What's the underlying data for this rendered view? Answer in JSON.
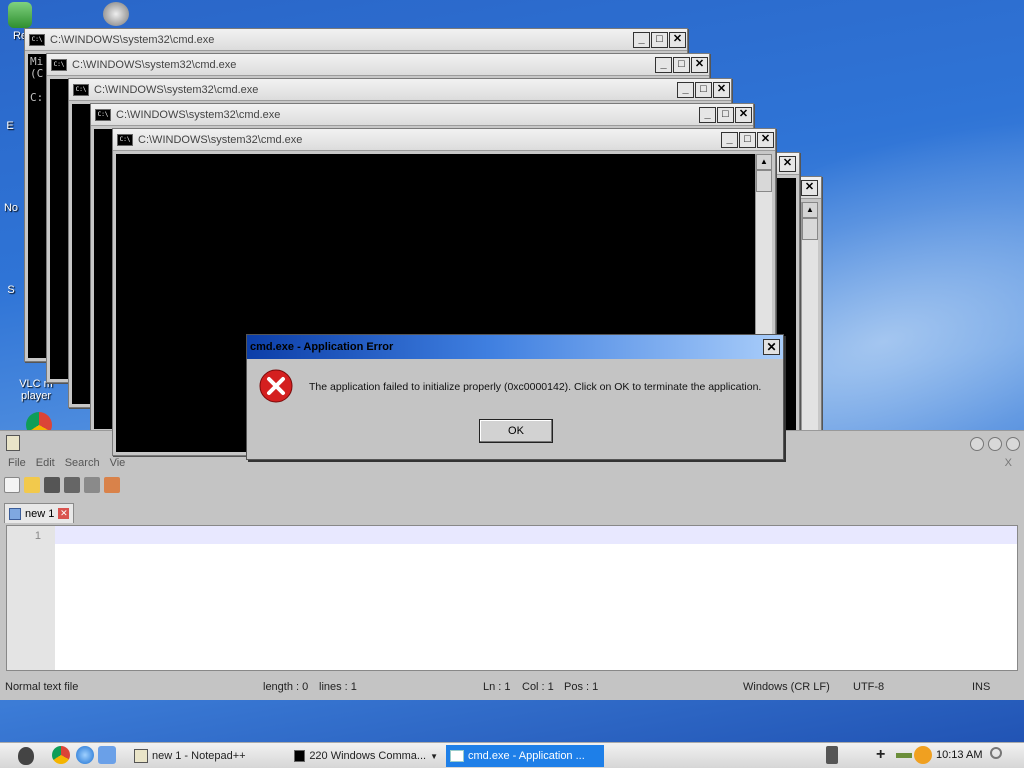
{
  "desktop": {
    "icons": [
      {
        "label": "Re"
      },
      {
        "label": "E"
      },
      {
        "label": "No"
      },
      {
        "label": "S"
      },
      {
        "label": "VLC m\nplayer"
      }
    ]
  },
  "cmd_windows": [
    {
      "title": "C:\\WINDOWS\\system32\\cmd.exe",
      "body_lines": [
        "Mi",
        "(C",
        "",
        "C:"
      ]
    },
    {
      "title": "C:\\WINDOWS\\system32\\cmd.exe"
    },
    {
      "title": "C:\\WINDOWS\\system32\\cmd.exe"
    },
    {
      "title": "C:\\WINDOWS\\system32\\cmd.exe"
    },
    {
      "title": "C:\\WINDOWS\\system32\\cmd.exe"
    }
  ],
  "cmd_icon_text": "C:\\",
  "window_controls": {
    "minimize": "_",
    "maximize": "□",
    "close": "✕"
  },
  "notepad": {
    "menu": [
      "File",
      "Edit",
      "Search",
      "Vie"
    ],
    "tab_label": "new 1",
    "line_number": "1",
    "close_x": "X",
    "status": {
      "file_type": "Normal text file",
      "length": "length : 0",
      "lines": "lines : 1",
      "ln": "Ln : 1",
      "col": "Col : 1",
      "pos": "Pos : 1",
      "eol": "Windows (CR LF)",
      "encoding": "UTF-8",
      "mode": "INS"
    }
  },
  "dialog": {
    "title": "cmd.exe - Application Error",
    "message": "The application failed to initialize properly (0xc0000142). Click on OK to terminate the application.",
    "ok_label": "OK"
  },
  "taskbar": {
    "tasks": [
      {
        "label": "new 1 - Notepad++"
      },
      {
        "label": "220 Windows Comma..."
      },
      {
        "label": "cmd.exe - Application ..."
      }
    ],
    "clock": "10:13 AM"
  }
}
